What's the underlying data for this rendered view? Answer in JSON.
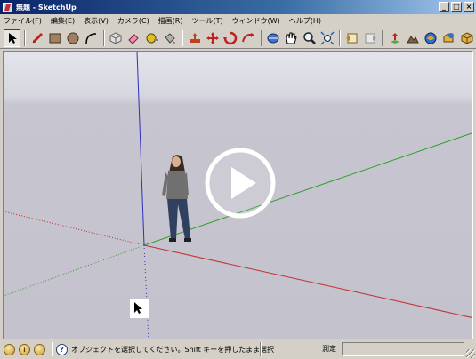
{
  "window": {
    "title": "無題 - SketchUp",
    "minimize": "_",
    "maximize": "□",
    "close": "×"
  },
  "menu": {
    "items": [
      "ファイル(F)",
      "編集(E)",
      "表示(V)",
      "カメラ(C)",
      "描画(R)",
      "ツール(T)",
      "ウィンドウ(W)",
      "ヘルプ(H)"
    ]
  },
  "toolbar": {
    "tools": [
      "select-icon",
      "pencil-icon",
      "rectangle-icon",
      "circle-icon",
      "arc-icon",
      "make-component-icon",
      "eraser-icon",
      "tape-measure-icon",
      "paint-bucket-icon",
      "push-pull-icon",
      "move-icon",
      "rotate-icon",
      "follow-me-icon",
      "orbit-icon",
      "pan-icon",
      "zoom-icon",
      "zoom-extents-icon",
      "previous-view-icon",
      "next-view-icon",
      "add-location-icon",
      "toggle-terrain-icon",
      "get-models-icon",
      "share-model-icon",
      "share-component-icon"
    ]
  },
  "statusbar": {
    "message": "オブジェクトを選択してください。Shift キーを押したまま選択",
    "measure_label": "測定",
    "measure_value": "",
    "help_symbol": "?"
  },
  "colors": {
    "axis_red": "#c03030",
    "axis_green": "#30a030",
    "axis_blue": "#3030c0",
    "sky": "#e4e4ec",
    "ground": "#c4c2cc"
  }
}
